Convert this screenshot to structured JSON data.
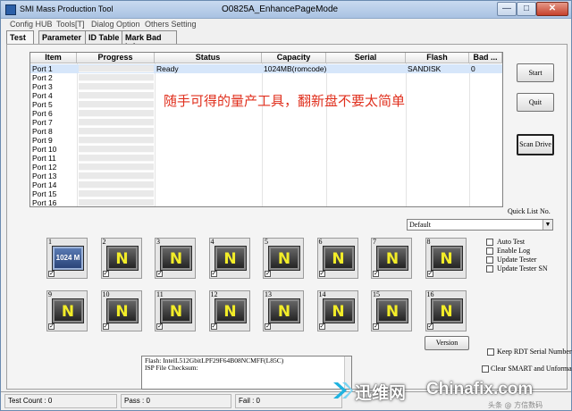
{
  "window": {
    "app_title": "SMI Mass Production Tool",
    "title": "O0825A_EnhancePageMode",
    "min_label": "—",
    "max_label": "□",
    "close_label": "✕"
  },
  "menu": [
    "Config HUB",
    "Tools[T]",
    "Dialog Option",
    "Others Setting"
  ],
  "tabs": [
    "Test",
    "Parameter",
    "ID Table",
    "Mark Bad Info"
  ],
  "table": {
    "columns": [
      "Item",
      "Progress",
      "Status",
      "Capacity",
      "Serial",
      "Flash",
      "Bad ..."
    ],
    "rows": [
      {
        "item": "Port 1",
        "status": "Ready",
        "capacity": "1024MB(romcode)",
        "serial": "",
        "flash": "SANDISK",
        "bad": "0"
      },
      {
        "item": "Port 2",
        "status": "",
        "capacity": "",
        "serial": "",
        "flash": "",
        "bad": ""
      },
      {
        "item": "Port 3",
        "status": "",
        "capacity": "",
        "serial": "",
        "flash": "",
        "bad": ""
      },
      {
        "item": "Port 4",
        "status": "",
        "capacity": "",
        "serial": "",
        "flash": "",
        "bad": ""
      },
      {
        "item": "Port 5",
        "status": "",
        "capacity": "",
        "serial": "",
        "flash": "",
        "bad": ""
      },
      {
        "item": "Port 6",
        "status": "",
        "capacity": "",
        "serial": "",
        "flash": "",
        "bad": ""
      },
      {
        "item": "Port 7",
        "status": "",
        "capacity": "",
        "serial": "",
        "flash": "",
        "bad": ""
      },
      {
        "item": "Port 8",
        "status": "",
        "capacity": "",
        "serial": "",
        "flash": "",
        "bad": ""
      },
      {
        "item": "Port 9",
        "status": "",
        "capacity": "",
        "serial": "",
        "flash": "",
        "bad": ""
      },
      {
        "item": "Port 10",
        "status": "",
        "capacity": "",
        "serial": "",
        "flash": "",
        "bad": ""
      },
      {
        "item": "Port 11",
        "status": "",
        "capacity": "",
        "serial": "",
        "flash": "",
        "bad": ""
      },
      {
        "item": "Port 12",
        "status": "",
        "capacity": "",
        "serial": "",
        "flash": "",
        "bad": ""
      },
      {
        "item": "Port 13",
        "status": "",
        "capacity": "",
        "serial": "",
        "flash": "",
        "bad": ""
      },
      {
        "item": "Port 14",
        "status": "",
        "capacity": "",
        "serial": "",
        "flash": "",
        "bad": ""
      },
      {
        "item": "Port 15",
        "status": "",
        "capacity": "",
        "serial": "",
        "flash": "",
        "bad": ""
      },
      {
        "item": "Port 16",
        "status": "",
        "capacity": "",
        "serial": "",
        "flash": "",
        "bad": ""
      }
    ]
  },
  "overlay_text": "随手可得的量产工具，翻新盘不要太简单",
  "buttons": {
    "start": "Start",
    "quit": "Quit",
    "scan_drive": "Scan Drive",
    "version": "Version"
  },
  "quick_list": {
    "label": "Quick List No.",
    "selected": "Default",
    "arrow": "▼"
  },
  "options": [
    {
      "label": "Auto Test",
      "checked": false
    },
    {
      "label": "Enable Log",
      "checked": false
    },
    {
      "label": "Update Tester",
      "checked": false
    },
    {
      "label": "Update Tester SN",
      "checked": false
    }
  ],
  "keep_rdt": {
    "label": "Keep RDT Serial Number",
    "checked": false
  },
  "clear_smart": {
    "label": "Clear SMART and Unformat",
    "checked": false
  },
  "slots": [
    {
      "num": "1",
      "state": "active",
      "label": "1024 M",
      "checked": true
    },
    {
      "num": "2",
      "state": "none",
      "label": "N",
      "checked": true
    },
    {
      "num": "3",
      "state": "none",
      "label": "N",
      "checked": true
    },
    {
      "num": "4",
      "state": "none",
      "label": "N",
      "checked": true
    },
    {
      "num": "5",
      "state": "none",
      "label": "N",
      "checked": true
    },
    {
      "num": "6",
      "state": "none",
      "label": "N",
      "checked": true
    },
    {
      "num": "7",
      "state": "none",
      "label": "N",
      "checked": true
    },
    {
      "num": "8",
      "state": "none",
      "label": "N",
      "checked": true
    },
    {
      "num": "9",
      "state": "none",
      "label": "N",
      "checked": true
    },
    {
      "num": "10",
      "state": "none",
      "label": "N",
      "checked": true
    },
    {
      "num": "11",
      "state": "none",
      "label": "N",
      "checked": true
    },
    {
      "num": "12",
      "state": "none",
      "label": "N",
      "checked": true
    },
    {
      "num": "13",
      "state": "none",
      "label": "N",
      "checked": true
    },
    {
      "num": "14",
      "state": "none",
      "label": "N",
      "checked": true
    },
    {
      "num": "15",
      "state": "none",
      "label": "N",
      "checked": true
    },
    {
      "num": "16",
      "state": "none",
      "label": "N",
      "checked": true
    }
  ],
  "info": {
    "line1": "Flash: IntelL512GbitLPF29F64B08NCMFF(L85C)",
    "line2": "ISP File Checksum:"
  },
  "status": {
    "test_count": "Test Count : 0",
    "pass": "Pass : 0",
    "fail": "Fail : 0"
  },
  "watermark": {
    "text_cn": "迅维网",
    "text_en": "Chinafix.com",
    "sub": "头条 @ 方信数码"
  },
  "colors": {
    "overlay_red": "#e0301e",
    "tile_letter_yellow": "#f2ec28",
    "selected_row": "#d6e6fa",
    "watermark_cyan": "#1fb3e0"
  }
}
